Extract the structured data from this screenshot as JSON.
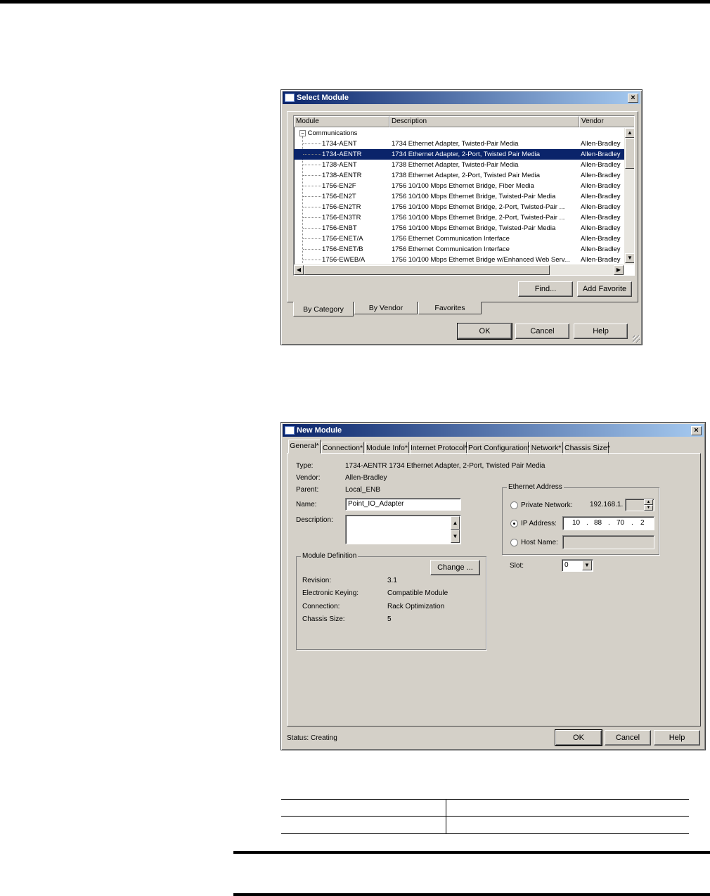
{
  "select_module": {
    "title": "Select Module",
    "close": "×",
    "headers": {
      "module": "Module",
      "description": "Description",
      "vendor": "Vendor"
    },
    "tree_root": "Communications",
    "tree_expander": "−",
    "rows": [
      {
        "module": "1734-AENT",
        "description": "1734 Ethernet Adapter, Twisted-Pair Media",
        "vendor": "Allen-Bradley"
      },
      {
        "module": "1734-AENTR",
        "description": "1734 Ethernet Adapter, 2-Port, Twisted Pair Media",
        "vendor": "Allen-Bradley",
        "selected": true
      },
      {
        "module": "1738-AENT",
        "description": "1738 Ethernet Adapter, Twisted-Pair Media",
        "vendor": "Allen-Bradley"
      },
      {
        "module": "1738-AENTR",
        "description": "1738 Ethernet Adapter, 2-Port, Twisted Pair Media",
        "vendor": "Allen-Bradley"
      },
      {
        "module": "1756-EN2F",
        "description": "1756 10/100 Mbps Ethernet Bridge, Fiber Media",
        "vendor": "Allen-Bradley"
      },
      {
        "module": "1756-EN2T",
        "description": "1756 10/100 Mbps Ethernet Bridge, Twisted-Pair Media",
        "vendor": "Allen-Bradley"
      },
      {
        "module": "1756-EN2TR",
        "description": "1756 10/100 Mbps Ethernet Bridge, 2-Port, Twisted-Pair ...",
        "vendor": "Allen-Bradley"
      },
      {
        "module": "1756-EN3TR",
        "description": "1756 10/100 Mbps Ethernet Bridge, 2-Port, Twisted-Pair ...",
        "vendor": "Allen-Bradley"
      },
      {
        "module": "1756-ENBT",
        "description": "1756 10/100 Mbps Ethernet Bridge, Twisted-Pair Media",
        "vendor": "Allen-Bradley"
      },
      {
        "module": "1756-ENET/A",
        "description": "1756 Ethernet Communication Interface",
        "vendor": "Allen-Bradley"
      },
      {
        "module": "1756-ENET/B",
        "description": "1756 Ethernet Communication Interface",
        "vendor": "Allen-Bradley"
      },
      {
        "module": "1756-EWEB/A",
        "description": "1756 10/100 Mbps Ethernet Bridge w/Enhanced Web Serv...",
        "vendor": "Allen-Bradley"
      }
    ],
    "find_button": "Find...",
    "add_favorite_button": "Add Favorite",
    "tabs": [
      "By Category",
      "By Vendor",
      "Favorites"
    ],
    "ok_button": "OK",
    "cancel_button": "Cancel",
    "help_button": "Help"
  },
  "new_module": {
    "title": "New Module",
    "close": "×",
    "tabs": [
      "General*",
      "Connection*",
      "Module Info*",
      "Internet Protocol*",
      "Port Configuration*",
      "Network*",
      "Chassis Size*"
    ],
    "type_label": "Type:",
    "type_value": "1734-AENTR 1734 Ethernet Adapter, 2-Port, Twisted Pair Media",
    "vendor_label": "Vendor:",
    "vendor_value": "Allen-Bradley",
    "parent_label": "Parent:",
    "parent_value": "Local_ENB",
    "name_label": "Name:",
    "name_value": "Point_IO_Adapter",
    "description_label": "Description:",
    "module_definition": {
      "title": "Module Definition",
      "change_button": "Change ...",
      "revision_label": "Revision:",
      "revision_value": "3.1",
      "keying_label": "Electronic Keying:",
      "keying_value": "Compatible Module",
      "connection_label": "Connection:",
      "connection_value": "Rack Optimization",
      "chassis_label": "Chassis Size:",
      "chassis_value": "5"
    },
    "ethernet": {
      "title": "Ethernet Address",
      "private_label": "Private Network:",
      "private_prefix": "192.168.1.",
      "ip_label": "IP Address:",
      "ip_octets": [
        "10",
        "88",
        "70",
        "2"
      ],
      "ip_dot": ".",
      "host_label": "Host Name:"
    },
    "slot_label": "Slot:",
    "slot_value": "0",
    "status_label": "Status:",
    "status_value": "Creating",
    "ok_button": "OK",
    "cancel_button": "Cancel",
    "help_button": "Help"
  }
}
